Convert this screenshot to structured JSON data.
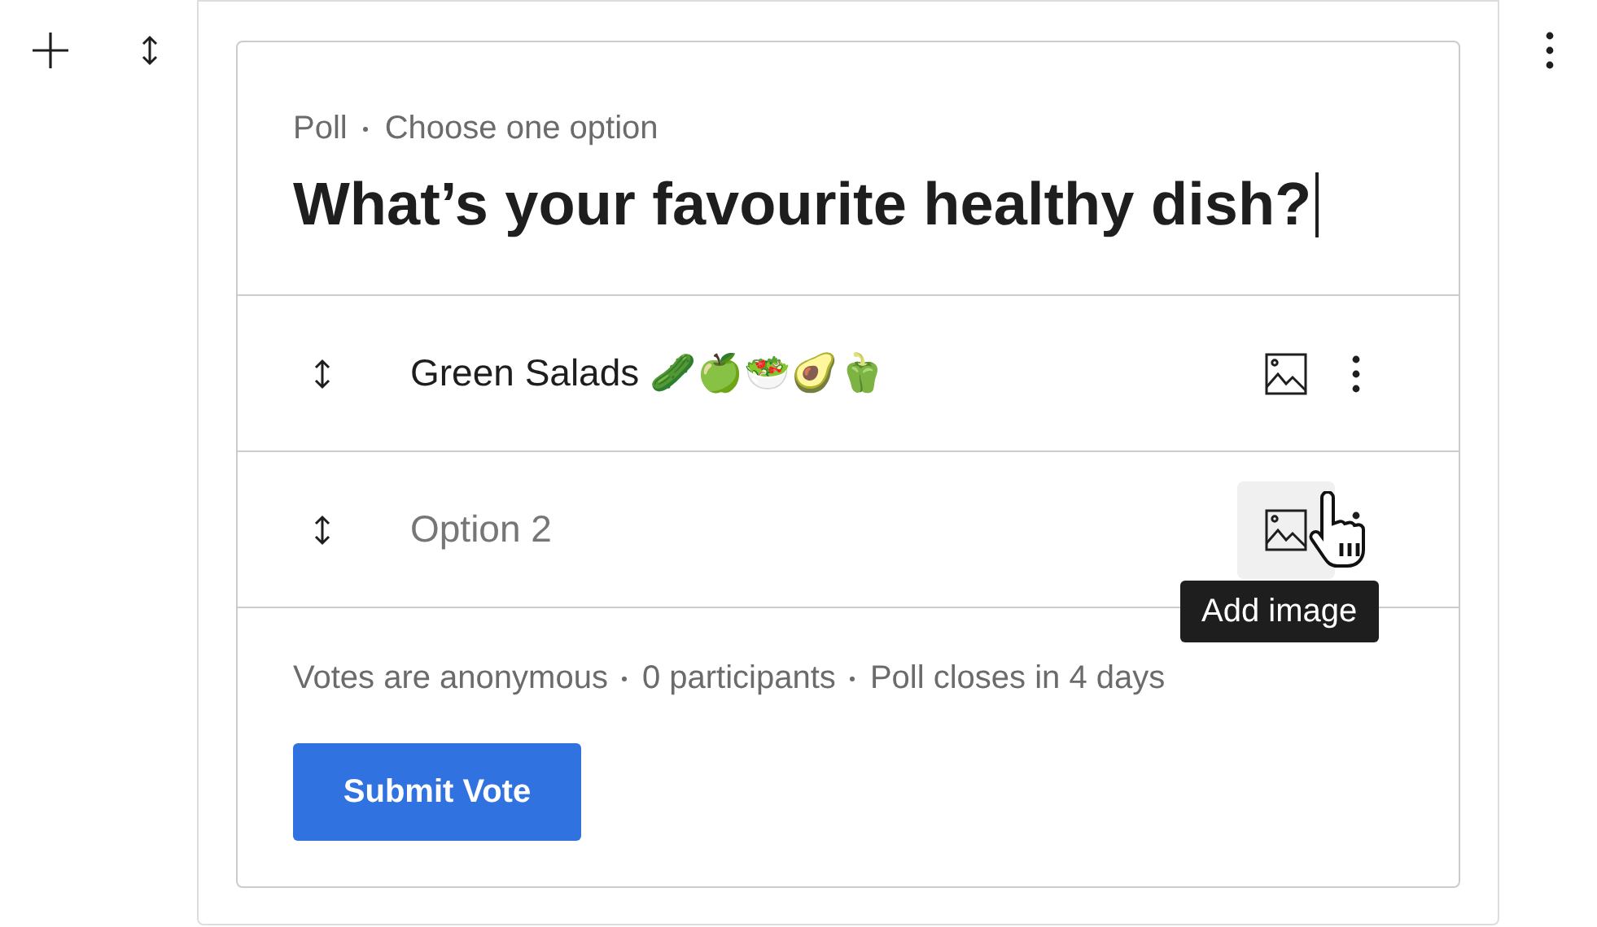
{
  "poll": {
    "type": "Poll",
    "mode": "Choose one option",
    "question": "What’s your favourite healthy dish?",
    "options": [
      {
        "value": "Green Salads 🥒🍏🥗🥑🫑",
        "hovered": false
      },
      {
        "placeholder": "Option 2",
        "hovered": true,
        "tooltip": "Add image"
      }
    ],
    "footer": [
      "Votes are anonymous",
      "0 participants",
      "Poll closes in 4 days"
    ],
    "submit": "Submit Vote"
  }
}
